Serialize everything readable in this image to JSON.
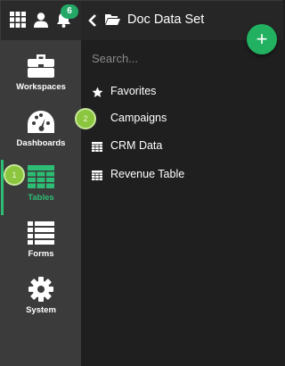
{
  "colors": {
    "accent": "#2dbd74",
    "rail": "#3b3b3b",
    "panel": "#1f1f1f",
    "step_marker": "#8cc63f"
  },
  "topbar": {
    "icons": [
      "apps-grid-icon",
      "user-icon",
      "bell-icon"
    ],
    "notification_count": "6"
  },
  "nav": {
    "items": [
      {
        "label": "Workspaces",
        "icon": "briefcase-icon"
      },
      {
        "label": "Dashboards",
        "icon": "gauge-icon"
      },
      {
        "label": "Tables",
        "icon": "table-icon",
        "active": true
      },
      {
        "label": "Forms",
        "icon": "list-icon"
      },
      {
        "label": "System",
        "icon": "gear-icon"
      }
    ]
  },
  "panel": {
    "title": "Doc Data Set",
    "search_placeholder": "Search...",
    "items": [
      {
        "label": "Favorites",
        "icon": "star-icon"
      },
      {
        "label": "Campaigns",
        "icon": "table-icon"
      },
      {
        "label": "CRM Data",
        "icon": "table-icon"
      },
      {
        "label": "Revenue Table",
        "icon": "table-icon"
      }
    ]
  },
  "step_markers": {
    "first": "1",
    "second": "2"
  }
}
